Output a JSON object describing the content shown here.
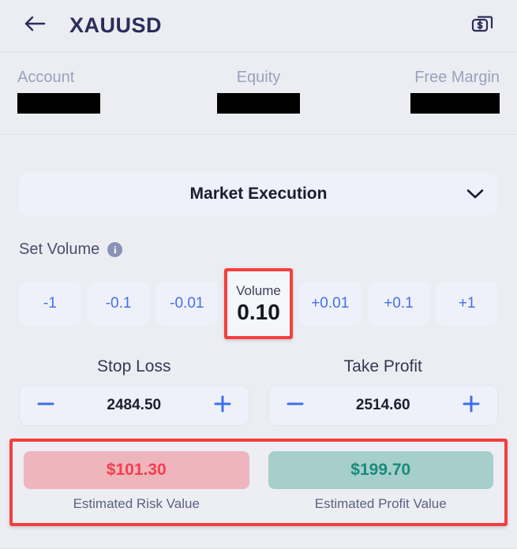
{
  "header": {
    "back_icon": "arrow-left-icon",
    "title": "XAUUSD",
    "money_icon": "money-bills-icon"
  },
  "account": {
    "cells": [
      {
        "label": "Account",
        "value": "",
        "redacted": true
      },
      {
        "label": "Equity",
        "value": "",
        "redacted": true
      },
      {
        "label": "Free Margin",
        "value": "",
        "redacted": true
      }
    ]
  },
  "execution": {
    "selected": "Market Execution",
    "chevron_icon": "chevron-down-icon"
  },
  "volume": {
    "section_label": "Set Volume",
    "info_icon": "info-icon",
    "info_glyph": "i",
    "decrement_buttons": [
      {
        "label": "-1"
      },
      {
        "label": "-0.1"
      },
      {
        "label": "-0.01"
      }
    ],
    "display": {
      "label": "Volume",
      "value": "0.10",
      "highlighted": true
    },
    "increment_buttons": [
      {
        "label": "+0.01"
      },
      {
        "label": "+0.1"
      },
      {
        "label": "+1"
      }
    ]
  },
  "stop_loss": {
    "label": "Stop Loss",
    "value": "2484.50",
    "minus_icon": "minus-icon",
    "plus_icon": "plus-icon"
  },
  "take_profit": {
    "label": "Take Profit",
    "value": "2514.60",
    "minus_icon": "minus-icon",
    "plus_icon": "plus-icon"
  },
  "estimates": {
    "highlighted": true,
    "risk": {
      "amount": "$101.30",
      "caption": "Estimated Risk Value"
    },
    "profit": {
      "amount": "$199.70",
      "caption": "Estimated Profit Value"
    }
  },
  "colors": {
    "page_background": "#ebedf2",
    "title": "#2b2d5c",
    "accent_blue": "#4470e8",
    "control_background": "#eef1f9",
    "highlight_red": "#f43f3f",
    "risk_background": "#eeb5bd",
    "risk_text": "#f43f50",
    "profit_background": "#a6cfcb",
    "profit_text": "#1a8a7a",
    "muted_text": "#9aa2bd"
  }
}
